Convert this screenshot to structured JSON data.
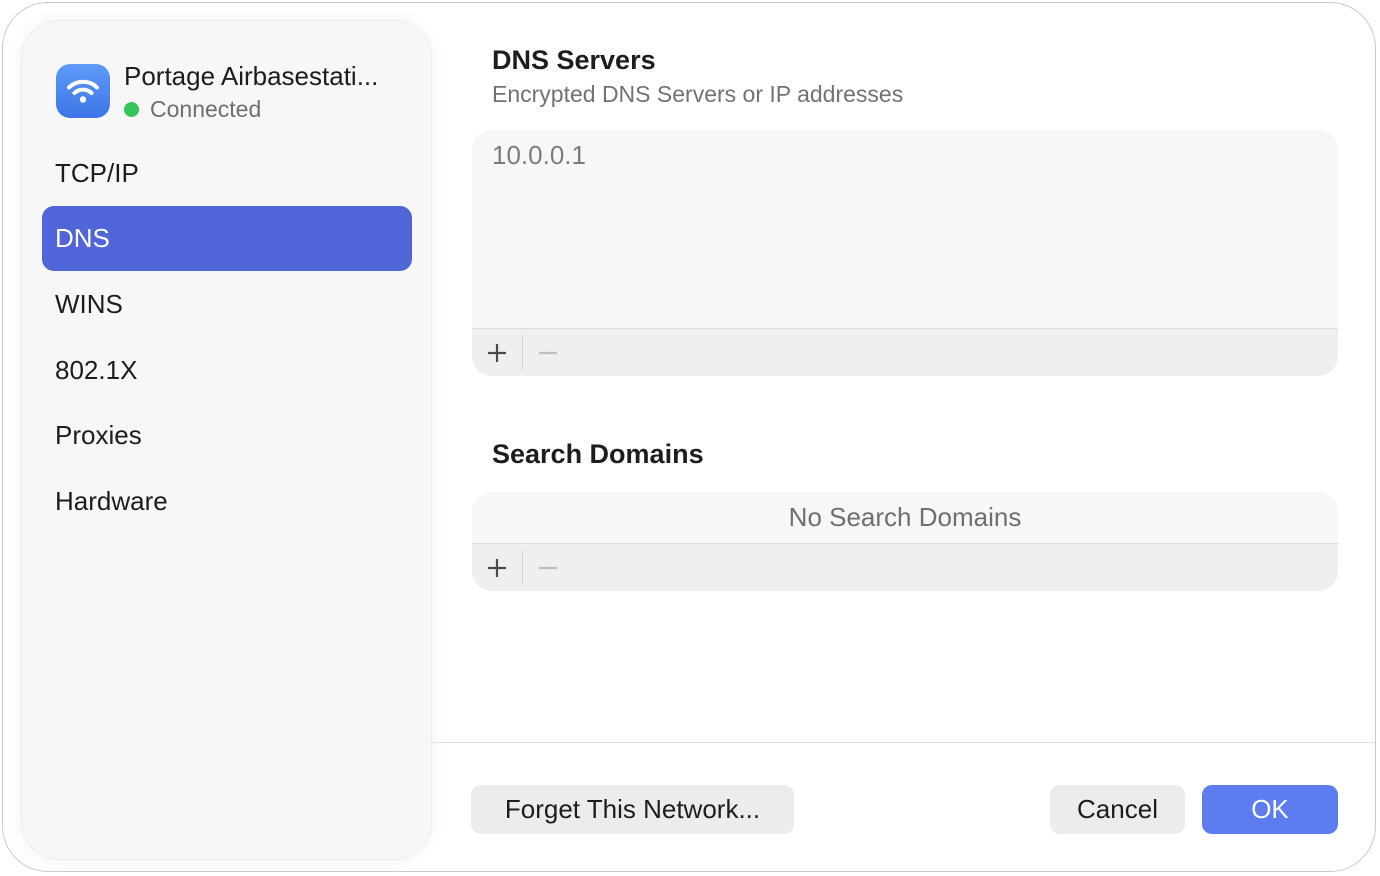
{
  "network": {
    "name": "Portage Airbasestati...",
    "status": "Connected",
    "icon": "wifi-icon"
  },
  "sidebar": {
    "items": [
      {
        "label": "TCP/IP",
        "selected": false
      },
      {
        "label": "DNS",
        "selected": true
      },
      {
        "label": "WINS",
        "selected": false
      },
      {
        "label": "802.1X",
        "selected": false
      },
      {
        "label": "Proxies",
        "selected": false
      },
      {
        "label": "Hardware",
        "selected": false
      }
    ]
  },
  "dns_servers": {
    "title": "DNS Servers",
    "subtitle": "Encrypted DNS Servers or IP addresses",
    "entries": [
      "10.0.0.1"
    ],
    "add_symbol": "+",
    "remove_symbol": "−"
  },
  "search_domains": {
    "title": "Search Domains",
    "placeholder": "No Search Domains",
    "add_symbol": "+",
    "remove_symbol": "−"
  },
  "footer": {
    "forget_label": "Forget This Network...",
    "cancel_label": "Cancel",
    "ok_label": "OK"
  },
  "colors": {
    "accent": "#5066d8",
    "primary_button": "#5c7cf0",
    "status_connected": "#32c55a"
  }
}
